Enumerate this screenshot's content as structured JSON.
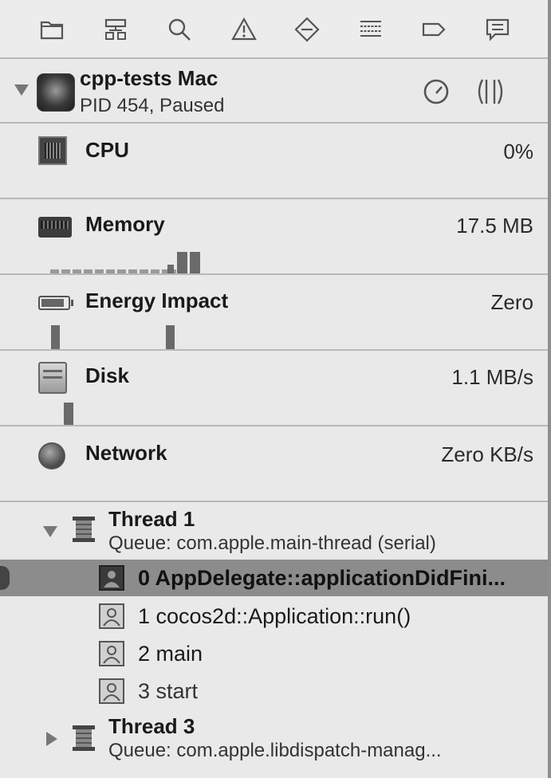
{
  "toolbar": {
    "icons": [
      "folder-icon",
      "hierarchy-icon",
      "search-icon",
      "warning-icon",
      "diamond-icon",
      "list-icon",
      "tag-icon",
      "comment-icon"
    ]
  },
  "process": {
    "name": "cpp-tests Mac",
    "status": "PID 454, Paused"
  },
  "gauges": {
    "cpu": {
      "label": "CPU",
      "value": "0%"
    },
    "memory": {
      "label": "Memory",
      "value": "17.5 MB"
    },
    "energy": {
      "label": "Energy Impact",
      "value": "Zero"
    },
    "disk": {
      "label": "Disk",
      "value": "1.1 MB/s"
    },
    "network": {
      "label": "Network",
      "value": "Zero KB/s"
    }
  },
  "threads": [
    {
      "name": "Thread 1",
      "queue": "Queue: com.apple.main-thread (serial)",
      "expanded": true,
      "frames": [
        {
          "label": "0 AppDelegate::applicationDidFini...",
          "selected": true
        },
        {
          "label": "1 cocos2d::Application::run()",
          "selected": false
        },
        {
          "label": "2 main",
          "selected": false
        },
        {
          "label": "3 start",
          "selected": false
        }
      ]
    },
    {
      "name": "Thread 3",
      "queue": "Queue: com.apple.libdispatch-manag...",
      "expanded": false
    }
  ],
  "colors": {
    "selection": "#8c8c8c",
    "separator": "#b9b9b9",
    "background": "#e9e9e9"
  }
}
